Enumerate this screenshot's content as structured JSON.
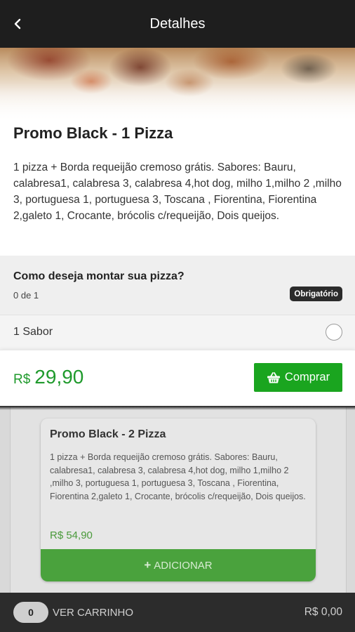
{
  "header": {
    "title": "Detalhes",
    "back_icon": "chevron-left-icon"
  },
  "product": {
    "title": "Promo Black - 1 Pizza",
    "description": "1 pizza + Borda requeijão cremoso grátis. Sabores: Bauru, calabresa1, calabresa 3, calabresa 4,hot dog, milho 1,milho 2 ,milho 3, portuguesa 1, portuguesa 3, Toscana , Fiorentina, Fiorentina 2,galeto 1, Crocante, brócolis c/requeijão, Dois queijos."
  },
  "question": {
    "title": "Como deseja montar sua pizza?",
    "count": "0 de 1",
    "required_badge": "Obrigatório"
  },
  "options": [
    {
      "label": "1 Sabor",
      "selected": false
    }
  ],
  "purchase": {
    "currency": "R$",
    "price": "29,90",
    "button_label": "Comprar",
    "button_icon": "shopping-basket-icon",
    "accent_color": "#1aa51f"
  },
  "background_card": {
    "title": "Promo Black - 2 Pizza",
    "description": "1 pizza + Borda requeijão cremoso grátis. Sabores: Bauru, calabresa1, calabresa 3, calabresa 4,hot dog, milho 1,milho 2 ,milho 3, portuguesa 1, portuguesa 3, Toscana , Fiorentina, Fiorentina 2,galeto 1, Crocante, brócolis c/requeijão, Dois queijos.",
    "price": "R$ 54,90",
    "add_label": "ADICIONAR"
  },
  "cart_bar": {
    "count": "0",
    "label": "VER CARRINHO",
    "total": "R$ 0,00"
  }
}
